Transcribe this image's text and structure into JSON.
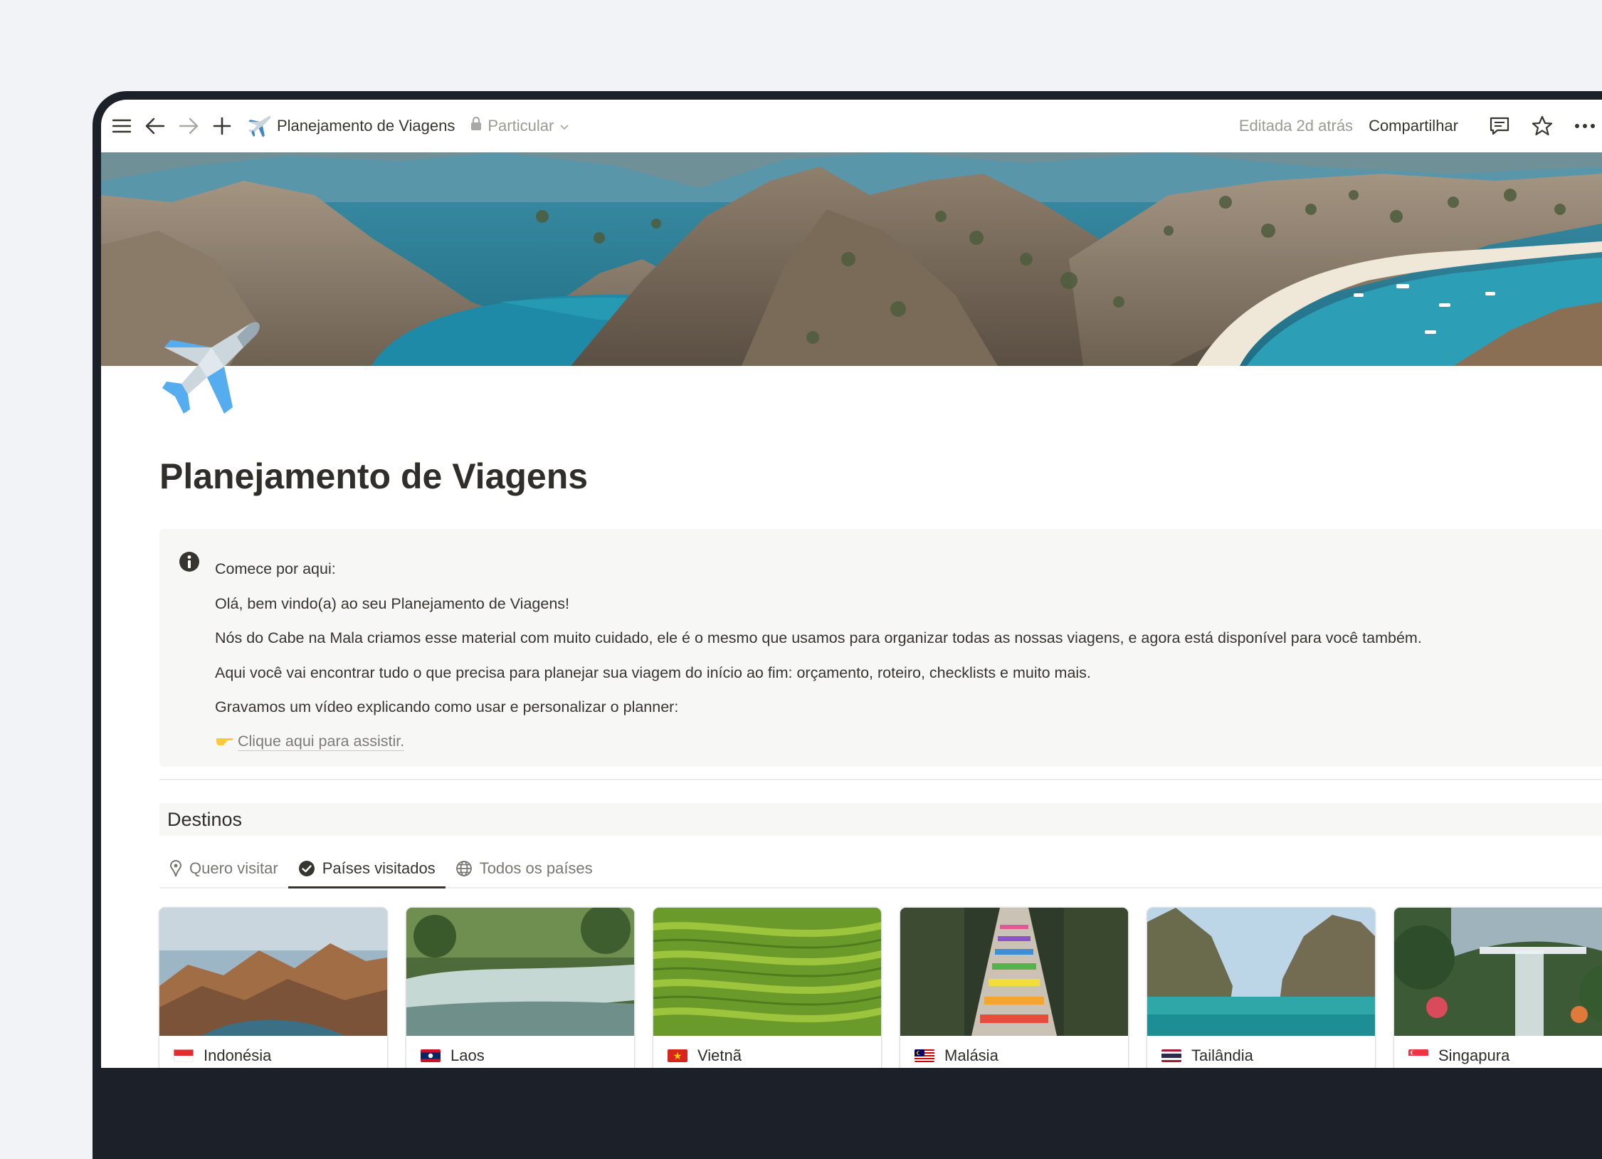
{
  "topbar": {
    "title": "Planejamento de Viagens",
    "privacy": "Particular",
    "edited": "Editada 2d atrás",
    "share": "Compartilhar",
    "icons": [
      "menu-icon",
      "back-arrow-icon",
      "forward-arrow-icon",
      "plus-icon",
      "airplane-icon",
      "lock-icon",
      "chevron-down-icon",
      "comment-icon",
      "star-icon",
      "more-icon"
    ]
  },
  "page": {
    "title": "Planejamento de Viagens",
    "emoji": "airplane-icon"
  },
  "callout": {
    "icon": "info-icon",
    "lines": [
      "Comece por aqui:",
      "Olá, bem vindo(a) ao seu Planejamento de Viagens!",
      "Nós do Cabe na Mala criamos esse material com muito cuidado, ele é o mesmo que usamos para organizar todas as nossas viagens, e agora está disponível para você também.",
      "Aqui você vai encontrar tudo o que precisa para planejar sua viagem do início ao fim: orçamento, roteiro, checklists e muito mais.",
      "Gravamos um vídeo explicando como usar e personalizar o planner:"
    ],
    "cta_icon": "pointing-hand-icon",
    "cta_link": "Clique aqui para assistir."
  },
  "database": {
    "title": "Destinos",
    "tabs": [
      {
        "label": "Quero visitar",
        "icon": "pin-icon",
        "active": false
      },
      {
        "label": "Países visitados",
        "icon": "check-circle-icon",
        "active": true
      },
      {
        "label": "Todos os países",
        "icon": "globe-icon",
        "active": false
      }
    ],
    "cards": [
      {
        "name": "Indonésia",
        "flag": "indonesia-flag-icon"
      },
      {
        "name": "Laos",
        "flag": "laos-flag-icon"
      },
      {
        "name": "Vietnã",
        "flag": "vietnam-flag-icon"
      },
      {
        "name": "Malásia",
        "flag": "malaysia-flag-icon"
      },
      {
        "name": "Tailândia",
        "flag": "thailand-flag-icon"
      },
      {
        "name": "Singapura",
        "flag": "singapore-flag-icon"
      }
    ]
  },
  "colors": {
    "background": "#f2f3f7",
    "frame": "#1c2028",
    "text": "#37352f",
    "muted": "#9b9a97",
    "callout_bg": "#f7f7f5"
  }
}
